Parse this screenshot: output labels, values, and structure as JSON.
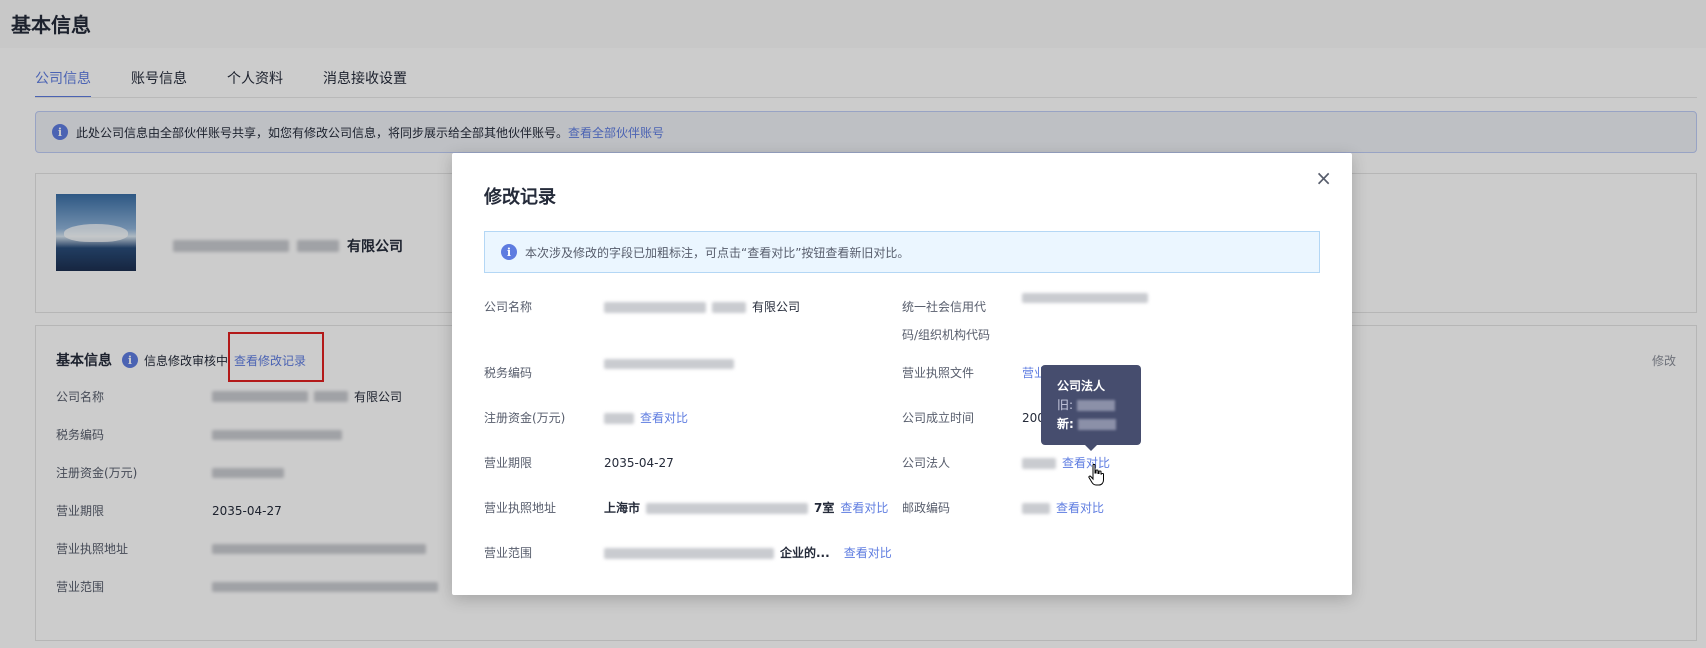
{
  "page": {
    "title": "基本信息"
  },
  "tabs": [
    {
      "label": "公司信息"
    },
    {
      "label": "账号信息"
    },
    {
      "label": "个人资料"
    },
    {
      "label": "消息接收设置"
    }
  ],
  "notice": {
    "text": "此处公司信息由全部伙伴账号共享，如您有修改公司信息，将同步展示给全部其他伙伴账号。",
    "link": "查看全部伙伴账号"
  },
  "company": {
    "name_suffix": "有限公司"
  },
  "basic_info": {
    "title": "基本信息",
    "status": "信息修改审核中",
    "view_records": "查看修改记录",
    "edit": "修改",
    "fields": [
      {
        "label": "公司名称",
        "value": "有限公司"
      },
      {
        "label": "税务编码",
        "value": ""
      },
      {
        "label": "注册资金(万元)",
        "value": ""
      },
      {
        "label": "营业期限",
        "value": "2035-04-27"
      },
      {
        "label": "营业执照地址",
        "value": ""
      },
      {
        "label": "营业范围",
        "value": ""
      }
    ]
  },
  "modal": {
    "title": "修改记录",
    "close": "×",
    "notice": "本次涉及修改的字段已加粗标注，可点击“查看对比”按钮查看新旧对比。",
    "compare": "查看对比",
    "left": [
      {
        "label": "公司名称",
        "value": "有限公司"
      },
      {
        "label": "税务编码",
        "value": ""
      },
      {
        "label": "注册资金(万元)",
        "value": ""
      },
      {
        "label": "营业期限",
        "value": "2035-04-27"
      },
      {
        "label": "营业执照地址",
        "value_prefix": "上海市",
        "value_suffix": "7室"
      },
      {
        "label": "营业范围",
        "value": "企业的..."
      }
    ],
    "right": [
      {
        "label_line1": "统一社会信用代",
        "label_line2": "码/组织机构代码"
      },
      {
        "label": "营业执照文件",
        "value": "营业"
      },
      {
        "label": "公司成立时间",
        "value": "200"
      },
      {
        "label": "公司法人"
      },
      {
        "label": "邮政编码"
      }
    ]
  },
  "tooltip": {
    "title": "公司法人",
    "old_label": "旧:",
    "new_label": "新:"
  },
  "colors": {
    "accent": "#5e7ce0",
    "highlight_border": "#e02020",
    "tooltip_bg": "#464d6e"
  }
}
